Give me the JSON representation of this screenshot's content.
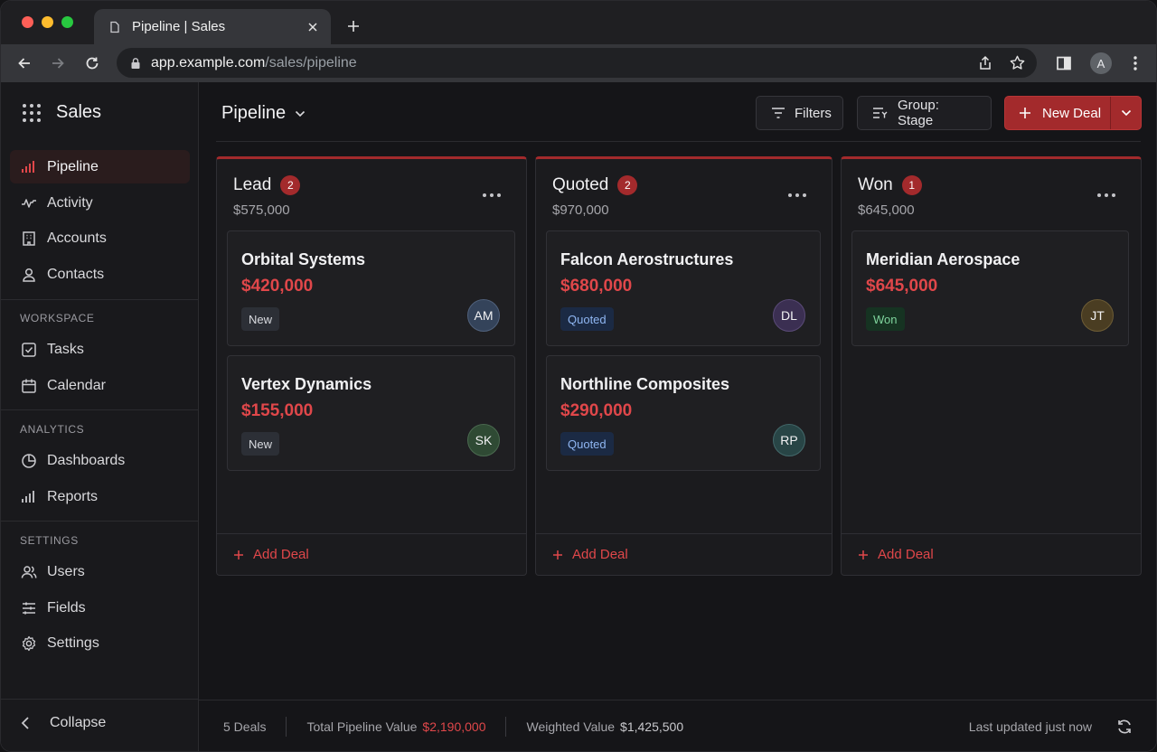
{
  "browser": {
    "tab_title": "Pipeline | Sales",
    "url_host": "app.example.com",
    "url_path": "/sales/pipeline",
    "profile_initial": "A"
  },
  "sidebar": {
    "brand": "Sales",
    "main_items": [
      {
        "label": "Pipeline",
        "icon": "bar-chart-icon",
        "active": true
      },
      {
        "label": "Activity",
        "icon": "activity-icon"
      },
      {
        "label": "Accounts",
        "icon": "building-icon"
      },
      {
        "label": "Contacts",
        "icon": "user-icon"
      }
    ],
    "workspace_title": "WORKSPACE",
    "workspace_items": [
      {
        "label": "Tasks",
        "icon": "checkbox-icon"
      },
      {
        "label": "Calendar",
        "icon": "calendar-icon"
      }
    ],
    "analytics_title": "ANALYTICS",
    "analytics_items": [
      {
        "label": "Dashboards",
        "icon": "pie-chart-icon"
      },
      {
        "label": "Reports",
        "icon": "bar-chart-icon"
      }
    ],
    "settings_title": "SETTINGS",
    "settings_items": [
      {
        "label": "Users",
        "icon": "users-icon"
      },
      {
        "label": "Fields",
        "icon": "sliders-icon"
      },
      {
        "label": "Settings",
        "icon": "gear-icon"
      }
    ],
    "collapse_label": "Collapse"
  },
  "header": {
    "title": "Pipeline",
    "filters_label": "Filters",
    "group_label": "Group: Stage",
    "new_deal_label": "New Deal"
  },
  "colors": {
    "accent": "#a32a2c",
    "amount": "#e0474a",
    "badge_quoted": "#8fb6f2",
    "badge_won": "#7fd49d"
  },
  "columns": [
    {
      "title": "Lead",
      "count": "2",
      "total": "$575,000",
      "cards": [
        {
          "name": "Orbital Systems",
          "amount": "$420,000",
          "badge": "New",
          "owner": "AM"
        },
        {
          "name": "Vertex Dynamics",
          "amount": "$155,000",
          "badge": "New",
          "owner": "SK"
        }
      ]
    },
    {
      "title": "Quoted",
      "count": "2",
      "total": "$970,000",
      "cards": [
        {
          "name": "Falcon Aerostructures",
          "amount": "$680,000",
          "badge": "Quoted",
          "owner": "DL"
        },
        {
          "name": "Northline Composites",
          "amount": "$290,000",
          "badge": "Quoted",
          "owner": "RP"
        }
      ]
    },
    {
      "title": "Won",
      "count": "1",
      "total": "$645,000",
      "cards": [
        {
          "name": "Meridian Aerospace",
          "amount": "$645,000",
          "badge": "Won",
          "owner": "JT"
        }
      ]
    }
  ],
  "add_deal_label": "Add Deal",
  "footer": {
    "deals": "5 Deals",
    "total_label": "Total Pipeline Value",
    "total_value": "$2,190,000",
    "weighted_label": "Weighted Value",
    "weighted_value": "$1,425,500",
    "updated": "Last updated just now"
  }
}
